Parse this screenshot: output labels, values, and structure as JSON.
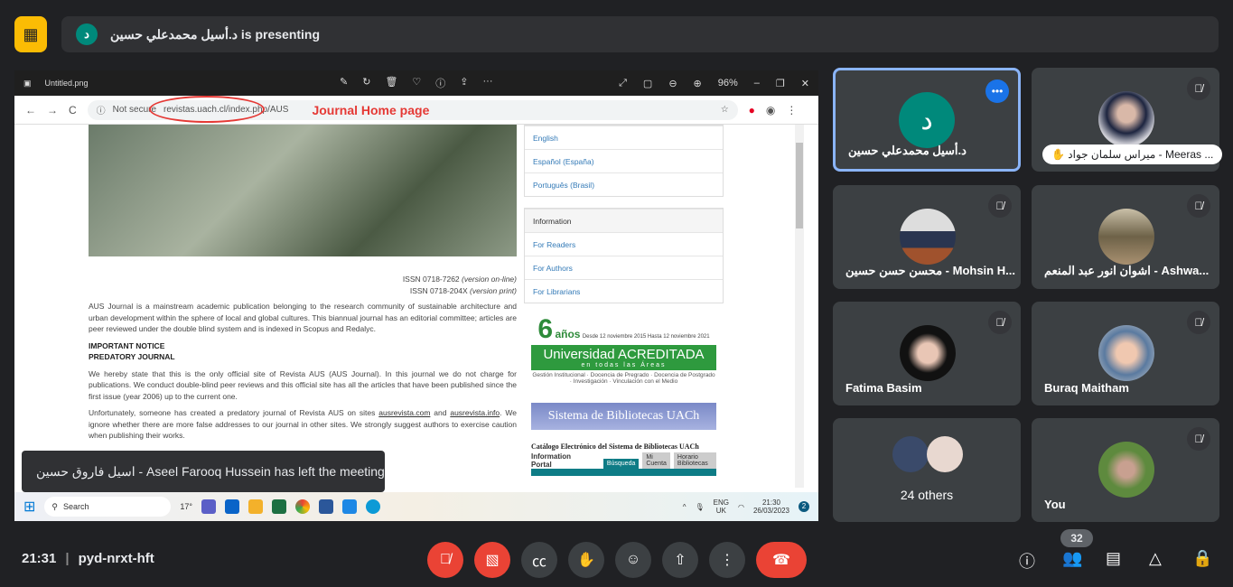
{
  "banner": {
    "presenter": "د.أسيل محمدعلي حسين",
    "suffix": "is presenting",
    "avatar_letter": "د"
  },
  "viewer": {
    "filename": "Untitled.png",
    "zoom": "96%"
  },
  "browser": {
    "security": "Not secure",
    "url": "revistas.uach.cl/index.php/AUS",
    "annotation": "Journal Home page"
  },
  "page": {
    "issn_online": "ISSN 0718-7262",
    "issn_online_note": "(version on-line)",
    "issn_print": "ISSN 0718-204X",
    "issn_print_note": "(version print)",
    "intro": "AUS Journal is a mainstream academic publication belonging to the research community of sustainable architecture and urban development within the sphere of local and global cultures. This biannual journal has an editorial committee; articles are peer reviewed under the double blind system and is indexed in Scopus and Redalyc.",
    "notice1": "IMPORTANT NOTICE",
    "notice2": "PREDATORY JOURNAL",
    "para2": "We hereby state that this is the only official site of Revista AUS (AUS Journal). In this journal we do not charge for publications. We conduct double-blind peer reviews and this official site has all the articles that have been published since the first issue (year 2006) up to the current one.",
    "para3a": "Unfortunately, someone has created a predatory journal of Revista AUS on sites ",
    "link1": "ausrevista.com",
    "para3b": " and ",
    "link2": "ausrevista.info",
    "para3c": ". We ignore whether there are more false addresses to our journal in other sites. We strongly suggest authors to exercise caution when publishing their works.",
    "languages": [
      "English",
      "Español (España)",
      "Português (Brasil)"
    ],
    "info_header": "Information",
    "info_links": [
      "For Readers",
      "For Authors",
      "For Librarians"
    ],
    "acc_six": "6",
    "acc_years": "años",
    "acc_dates": "Desde 12 noviembre 2015 Hasta 12 noviembre 2021",
    "acc_title": "Universidad ACREDITADA",
    "acc_areas": "en todas las Áreas",
    "acc_sub": "Gestión Institucional · Docencia de Pregrado · Docencia de Postgrado · Investigación · Vinculación con el Medio",
    "bib": "Sistema de Bibliotecas UACh",
    "catalog": "Catálogo Electrónico del Sistema de Bibliotecas UACh",
    "portal": "Information Portal",
    "portal_tabs": [
      "Búsqueda",
      "Mi Cuenta",
      "Horario Bibliotecas"
    ]
  },
  "taskbar": {
    "search": "Search",
    "weather": "17°",
    "lang": "ENG",
    "region": "UK",
    "time": "21:30",
    "date": "26/03/2023",
    "badge": "2"
  },
  "toast": "اسيل فاروق حسين - Aseel Farooq Hussein has left the meeting",
  "participants": [
    {
      "name": "د.أسيل محمدعلي حسين",
      "letter": "د",
      "color": "#00897b"
    },
    {
      "name": "ميراس سلمان جواد - Meeras ..."
    },
    {
      "name": "محسن حسن حسين - Mohsin H..."
    },
    {
      "name": "اشوان انور عبد المنعم - Ashwa..."
    },
    {
      "name": "Fatima Basim"
    },
    {
      "name": "Buraq Maitham"
    },
    {
      "name": "24 others"
    },
    {
      "name": "You"
    }
  ],
  "meeting": {
    "time": "21:31",
    "code": "pyd-nrxt-hft",
    "participant_count": "32"
  }
}
